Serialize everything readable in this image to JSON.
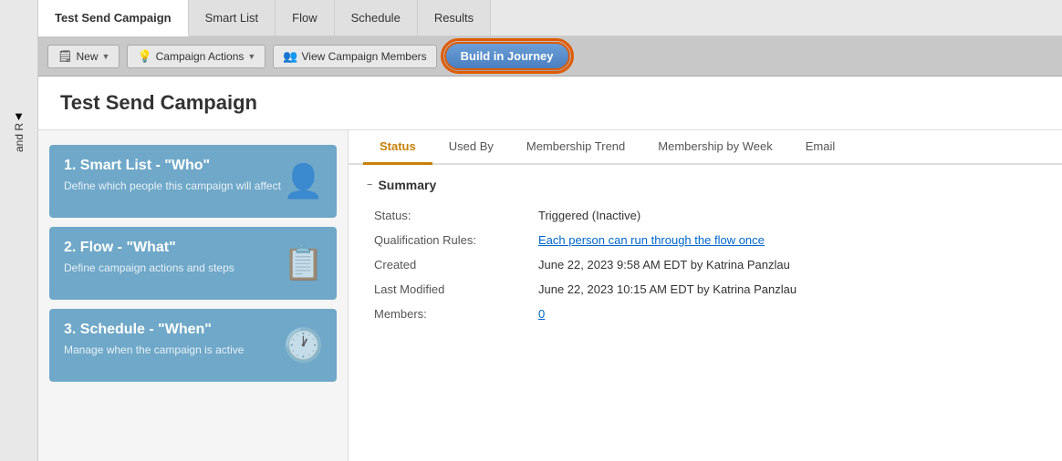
{
  "sidebar": {
    "filter_icon": "▼",
    "and_label": "and R"
  },
  "top_tabs": [
    {
      "id": "test-send",
      "label": "Test Send Campaign",
      "active": true
    },
    {
      "id": "smart-list",
      "label": "Smart List",
      "active": false
    },
    {
      "id": "flow",
      "label": "Flow",
      "active": false
    },
    {
      "id": "schedule",
      "label": "Schedule",
      "active": false
    },
    {
      "id": "results",
      "label": "Results",
      "active": false
    }
  ],
  "toolbar": {
    "new_label": "New",
    "new_icon": "🗒",
    "campaign_actions_label": "Campaign Actions",
    "campaign_actions_icon": "💡",
    "view_members_label": "View Campaign Members",
    "view_members_icon": "👥",
    "build_journey_label": "Build in Journey"
  },
  "page": {
    "title": "Test Send Campaign"
  },
  "left_panels": [
    {
      "id": "smart-list",
      "title": "1. Smart List - \"Who\"",
      "description": "Define which people this campaign will affect",
      "icon": "👤"
    },
    {
      "id": "flow",
      "title": "2. Flow - \"What\"",
      "description": "Define campaign actions and steps",
      "icon": "📋"
    },
    {
      "id": "schedule",
      "title": "3. Schedule - \"When\"",
      "description": "Manage when the campaign is active",
      "icon": "🕐"
    }
  ],
  "inner_tabs": [
    {
      "id": "status",
      "label": "Status",
      "active": true
    },
    {
      "id": "used-by",
      "label": "Used By",
      "active": false
    },
    {
      "id": "membership-trend",
      "label": "Membership Trend",
      "active": false
    },
    {
      "id": "membership-by-week",
      "label": "Membership by Week",
      "active": false
    },
    {
      "id": "email",
      "label": "Email",
      "active": false
    }
  ],
  "summary": {
    "header_label": "Summary",
    "collapse_icon": "−",
    "fields": [
      {
        "label": "Status:",
        "value": "Triggered (Inactive)",
        "is_link": false
      },
      {
        "label": "Qualification Rules:",
        "value": "Each person can run through the flow once",
        "is_link": true
      },
      {
        "label": "Created",
        "value": "June 22, 2023 9:58 AM EDT by Katrina Panzlau",
        "is_link": false
      },
      {
        "label": "Last Modified",
        "value": "June 22, 2023 10:15 AM EDT by Katrina Panzlau",
        "is_link": false
      },
      {
        "label": "Members:",
        "value": "0",
        "is_link": true
      }
    ]
  }
}
